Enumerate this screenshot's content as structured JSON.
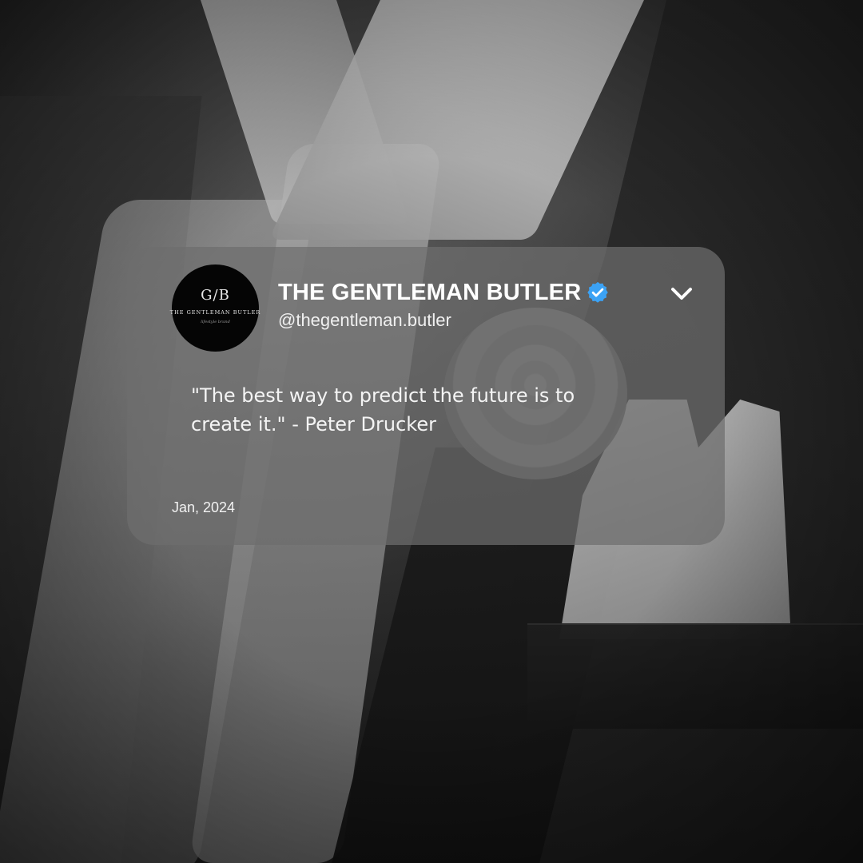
{
  "post": {
    "display_name": "THE GENTLEMAN BUTLER",
    "handle": "@thegentleman.butler",
    "verified": true,
    "quote": "\"The best way to predict the future is to create it.\" - Peter Drucker",
    "date": "Jan, 2024"
  },
  "avatar": {
    "monogram": "G/B",
    "brand_name": "THE GENTLEMAN BUTLER",
    "tagline": "lifestyle brand"
  },
  "icons": {
    "verified": "verified-badge-icon",
    "menu": "chevron-down-icon"
  },
  "colors": {
    "card_bg": "#6e6e6e",
    "verified_blue": "#3ba2f5",
    "text": "#ffffff"
  }
}
